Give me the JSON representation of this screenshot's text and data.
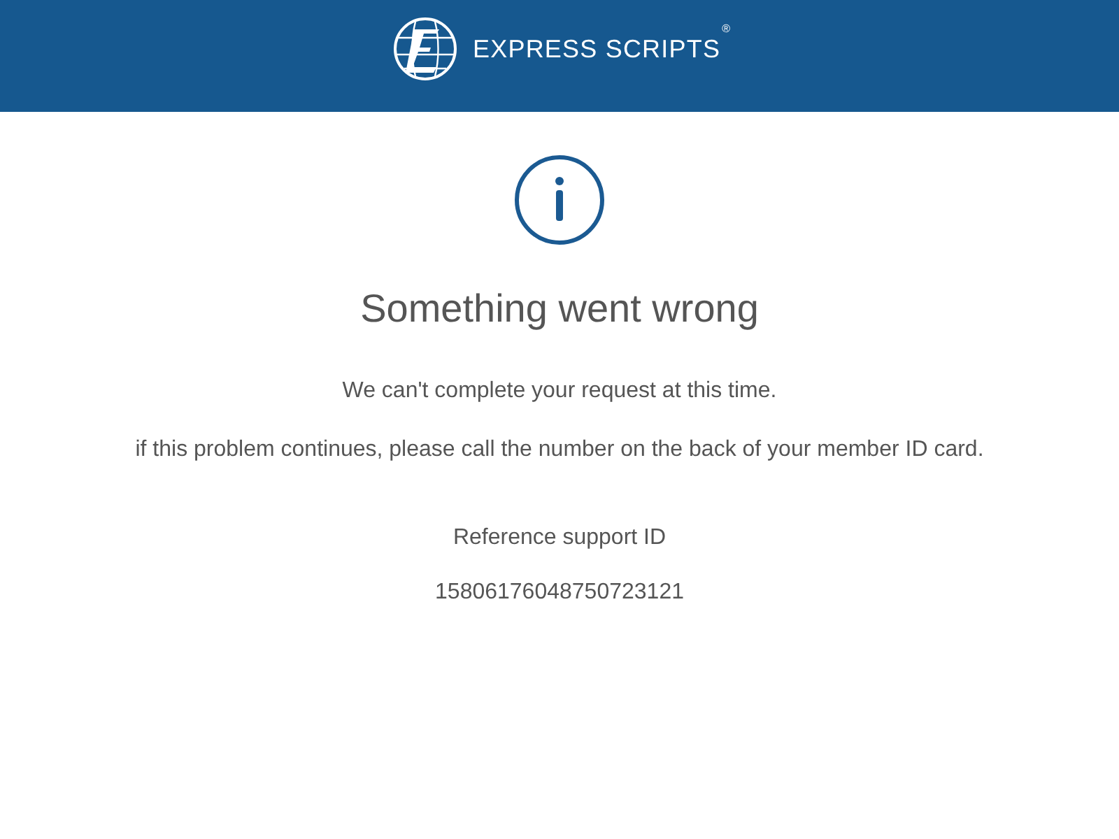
{
  "header": {
    "logo": {
      "wordmark": "EXPRESS SCRIPTS",
      "mark": "®"
    }
  },
  "message": {
    "title": "Something went wrong",
    "paragraphs": [
      "We can't complete your request at this time.",
      "if this problem continues, please call the number on the back of your member ID card."
    ]
  },
  "reference": {
    "label": "Reference support ID",
    "value": "15806176048750723121"
  }
}
